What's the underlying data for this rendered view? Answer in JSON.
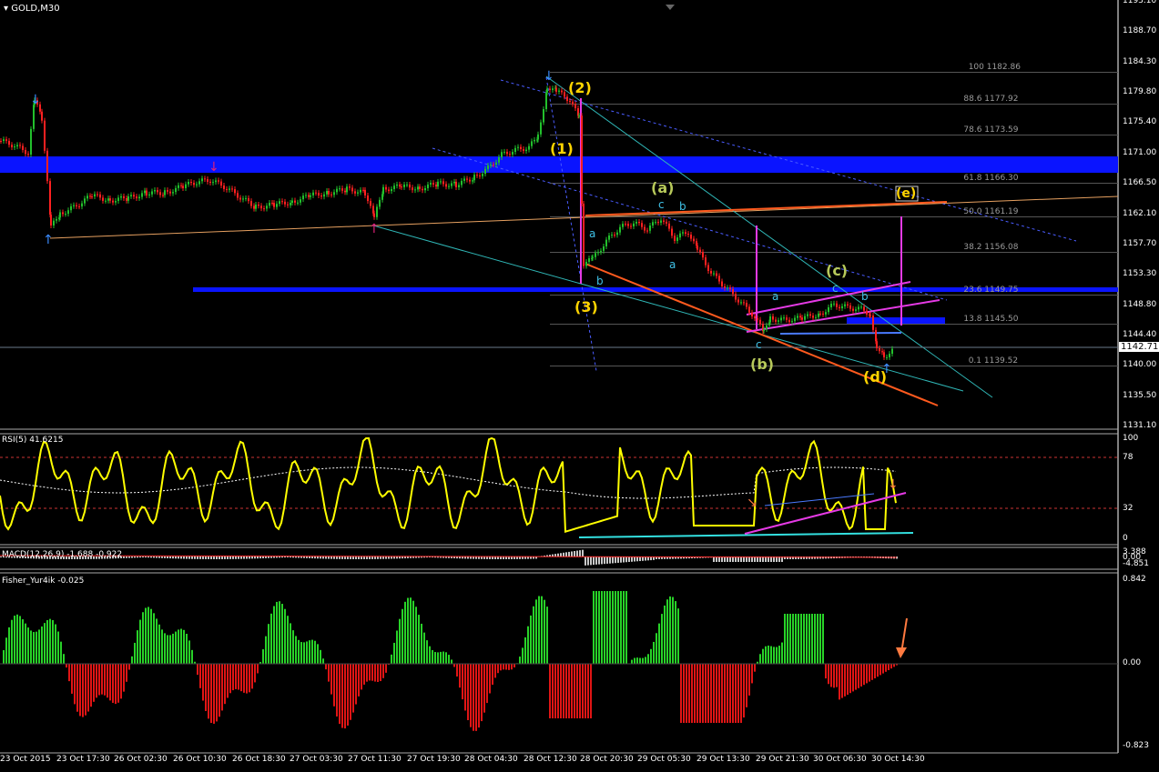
{
  "header": {
    "symbol_label": "GOLD,M30",
    "menu_icon": "triangle-down-icon"
  },
  "price_axis": {
    "labels": [
      "1193.10",
      "1188.70",
      "1184.30",
      "1179.80",
      "1175.40",
      "1171.00",
      "1166.50",
      "1162.10",
      "1157.70",
      "1153.30",
      "1148.80",
      "1144.40",
      "1140.00",
      "1135.50",
      "1131.10"
    ],
    "current_price": "1142.71"
  },
  "time_axis": {
    "labels": [
      "23 Oct 2015",
      "23 Oct 17:30",
      "26 Oct 02:30",
      "26 Oct 10:30",
      "26 Oct 18:30",
      "27 Oct 03:30",
      "27 Oct 11:30",
      "27 Oct 19:30",
      "28 Oct 04:30",
      "28 Oct 12:30",
      "28 Oct 20:30",
      "29 Oct 05:30",
      "29 Oct 13:30",
      "29 Oct 21:30",
      "30 Oct 06:30",
      "30 Oct 14:30"
    ]
  },
  "fibonacci": {
    "levels": [
      "100 1182.86",
      "88.6 1177.92",
      "78.6 1173.59",
      "61.8 1166.30",
      "50.0 1161.19",
      "38.2 1156.08",
      "23.6 1149.75",
      "13.8 1145.50",
      "0.1 1139.52"
    ]
  },
  "wave_labels": {
    "primary": [
      "(1)",
      "(2)",
      "(3)"
    ],
    "secondary": [
      "(a)",
      "(b)",
      "(c)",
      "(d)",
      "(e)"
    ],
    "minor": [
      "a",
      "b",
      "c",
      "a",
      "b",
      "c",
      "a",
      "b",
      "c"
    ]
  },
  "rsi_panel": {
    "title": "RSI(5) 41.6215",
    "levels": [
      "100",
      "78",
      "32",
      "0"
    ]
  },
  "macd_panel": {
    "title": "MACD(12,26,9) -1.688 -0.922",
    "levels": [
      "3.388",
      "0.00",
      "-4.851"
    ]
  },
  "fisher_panel": {
    "title": "Fisher_Yur4ik -0.025",
    "levels": [
      "0.842",
      "0.00",
      "-0.823"
    ]
  },
  "colors": {
    "bull_candle": "#22c02c",
    "bear_candle": "#ff2020",
    "support_band": "#0a14ff",
    "trend_orange": "#ff5a1e",
    "channel_magenta": "#e53ae5",
    "rsi_line": "#ffff00",
    "fisher_up": "#28d228",
    "fisher_down": "#e01515"
  }
}
